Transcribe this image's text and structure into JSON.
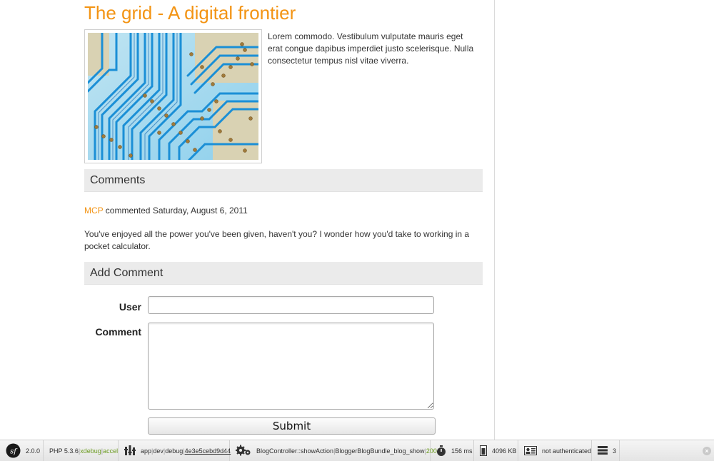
{
  "post": {
    "title": "The grid - A digital frontier",
    "body": "Lorem commodo. Vestibulum vulputate mauris eget erat congue dapibus imperdiet justo scelerisque. Nulla consectetur tempus nisl vitae viverra."
  },
  "comments": {
    "header": "Comments",
    "items": [
      {
        "author": "MCP",
        "meta": " commented Saturday, August 6, 2011",
        "body": "You've enjoyed all the power you've been given, haven't you? I wonder how you'd take to working in a pocket calculator."
      }
    ]
  },
  "add_comment": {
    "header": "Add Comment",
    "user_label": "User",
    "comment_label": "Comment",
    "user_value": "",
    "comment_value": "",
    "submit_label": "Submit"
  },
  "toolbar": {
    "symfony_version": "2.0.0",
    "php": {
      "version": "PHP 5.3.6",
      "xdebug": "xdebug",
      "accel": "accel"
    },
    "env": {
      "app": "app",
      "env": "dev",
      "debug": "debug",
      "token": "4e3e5cebd9d44"
    },
    "controller": {
      "action": "BlogController::showAction",
      "route": "BloggerBlogBundle_blog_show",
      "status": "200"
    },
    "time": "156 ms",
    "memory": "4096 KB",
    "security": "not authenticated",
    "queries": "3",
    "sep": "|"
  },
  "colors": {
    "accent": "#f39414",
    "section_bg": "#ebebeb",
    "toolbar_green": "#6a9a1f"
  }
}
